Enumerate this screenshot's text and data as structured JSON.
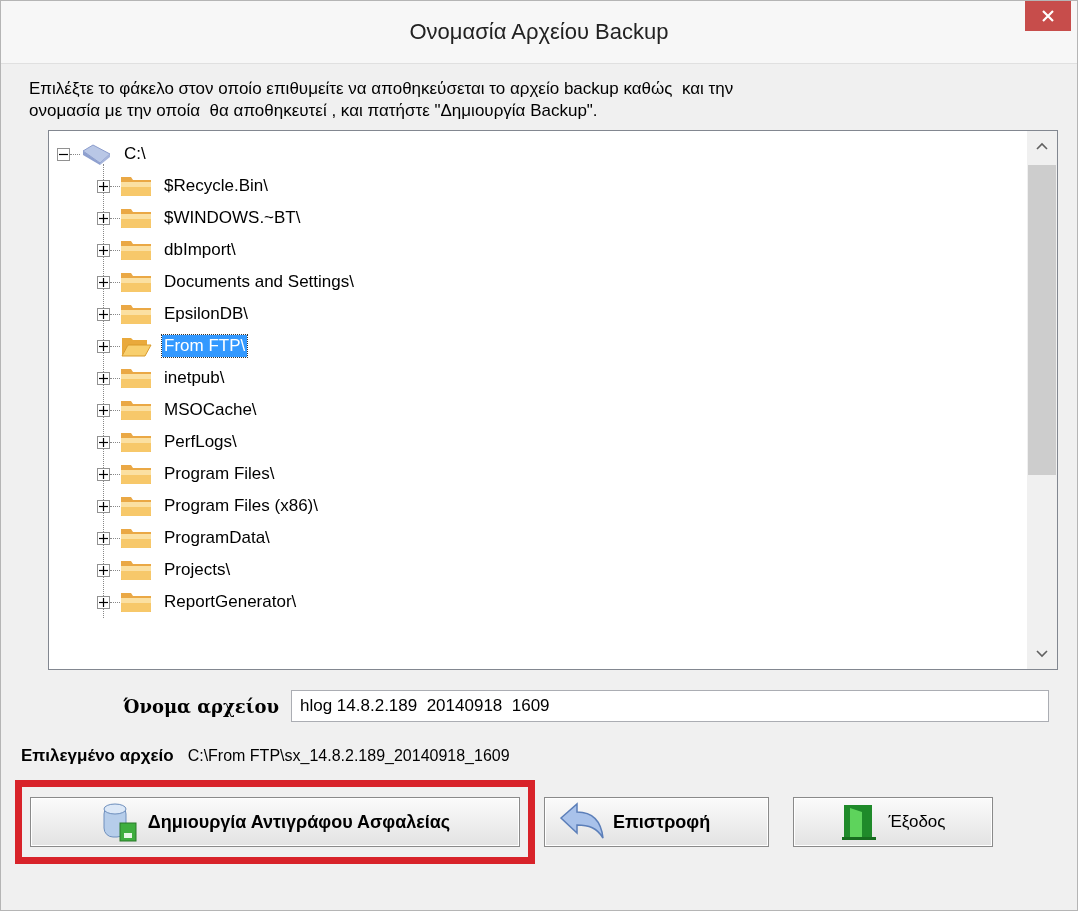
{
  "window": {
    "title": "Ονομασία Αρχείου Backup"
  },
  "instructions": "Επιλέξτε το φάκελο στον οποίο επιθυμείτε να αποθηκεύσεται το αρχείο backup καθώς  και την ονομασία με την οποία  θα αποθηκευτεί , και πατήστε \"Δημιουργία Backup\".",
  "tree": {
    "items": [
      {
        "label": "C:\\",
        "kind": "drive",
        "expanded": true,
        "selected": false,
        "children": [
          {
            "label": "$Recycle.Bin\\",
            "kind": "folder",
            "expanded": false,
            "selected": false
          },
          {
            "label": "$WINDOWS.~BT\\",
            "kind": "folder",
            "expanded": false,
            "selected": false
          },
          {
            "label": "dbImport\\",
            "kind": "folder",
            "expanded": false,
            "selected": false
          },
          {
            "label": "Documents and Settings\\",
            "kind": "folder",
            "expanded": false,
            "selected": false
          },
          {
            "label": "EpsilonDB\\",
            "kind": "folder",
            "expanded": false,
            "selected": false
          },
          {
            "label": "From FTP\\",
            "kind": "folder",
            "expanded": false,
            "selected": true
          },
          {
            "label": "inetpub\\",
            "kind": "folder",
            "expanded": false,
            "selected": false
          },
          {
            "label": "MSOCache\\",
            "kind": "folder",
            "expanded": false,
            "selected": false
          },
          {
            "label": "PerfLogs\\",
            "kind": "folder",
            "expanded": false,
            "selected": false
          },
          {
            "label": "Program Files\\",
            "kind": "folder",
            "expanded": false,
            "selected": false
          },
          {
            "label": "Program Files (x86)\\",
            "kind": "folder",
            "expanded": false,
            "selected": false
          },
          {
            "label": "ProgramData\\",
            "kind": "folder",
            "expanded": false,
            "selected": false
          },
          {
            "label": "Projects\\",
            "kind": "folder",
            "expanded": false,
            "selected": false
          },
          {
            "label": "ReportGenerator\\",
            "kind": "folder",
            "expanded": false,
            "selected": false
          }
        ]
      }
    ]
  },
  "file_name": {
    "label": "Όνομα αρχείου",
    "value": "hlog 14.8.2.189  20140918  1609"
  },
  "selected_file": {
    "label": "Επιλεγμένο αρχείο",
    "value": "C:\\From FTP\\sx_14.8.2.189_20140918_1609"
  },
  "buttons": [
    {
      "label": "Δημιουργία Αντιγράφου Ασφαλείας",
      "kind": "create",
      "highlighted": true
    },
    {
      "label": "Επιστροφή",
      "kind": "back",
      "highlighted": false
    },
    {
      "label": "Έξοδος",
      "kind": "exit",
      "highlighted": false
    }
  ]
}
